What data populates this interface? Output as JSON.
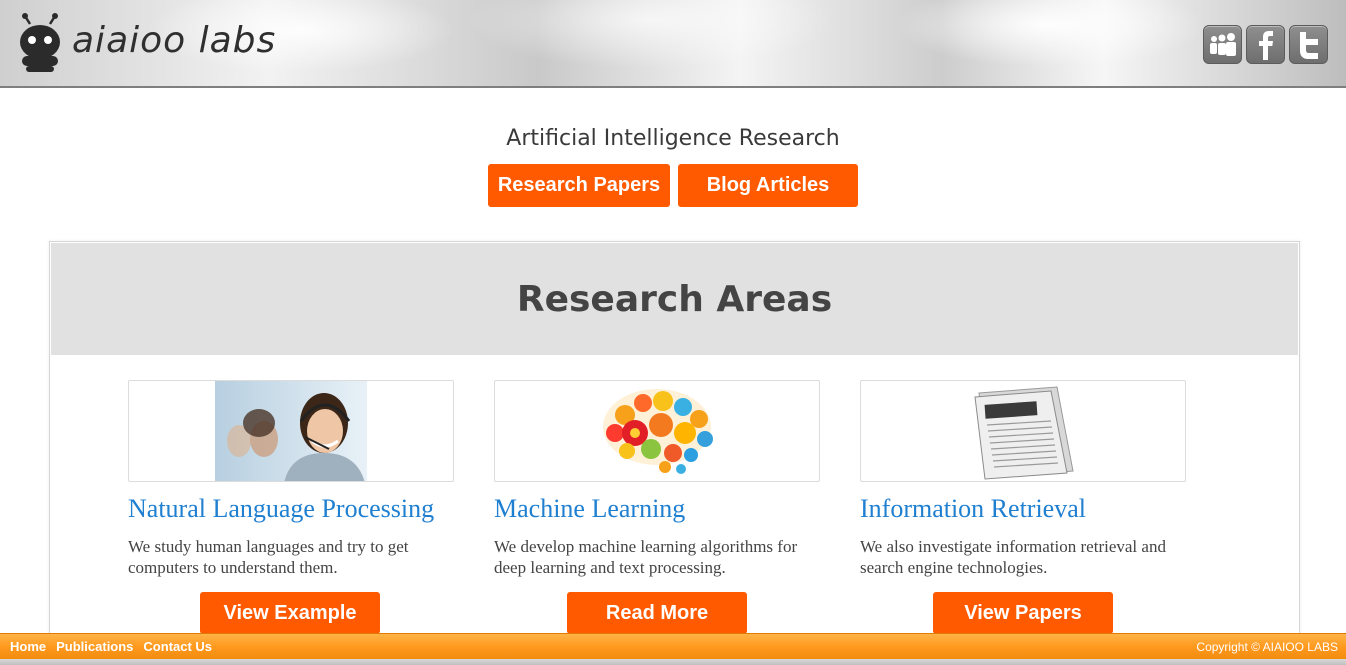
{
  "header": {
    "logo_text": "aiaioo labs",
    "social": [
      {
        "icon": "myspace-icon"
      },
      {
        "icon": "facebook-icon"
      },
      {
        "icon": "twitter-icon"
      }
    ]
  },
  "hero": {
    "title": "Artificial Intelligence Research",
    "buttons": {
      "papers": "Research Papers",
      "blog": "Blog Articles"
    }
  },
  "research": {
    "title": "Research Areas",
    "cards": [
      {
        "title": "Natural Language Processing",
        "text": "We study human languages and try to get computers to understand them.",
        "button": "View Example",
        "image": "call-center-agent-image"
      },
      {
        "title": "Machine Learning",
        "text": "We develop machine learning algorithms for deep learning and text processing.",
        "button": "Read More",
        "image": "gear-brain-image"
      },
      {
        "title": "Information Retrieval",
        "text": "We also investigate information retrieval and search engine technologies.",
        "button": "View Papers",
        "image": "newspaper-image"
      }
    ]
  },
  "footer": {
    "links": [
      "Home",
      "Publications",
      "Contact Us"
    ],
    "copyright": "Copyright © AIAIOO LABS"
  },
  "colors": {
    "accent_orange": "#ff5a00",
    "link_blue": "#1f7fd0",
    "footer_orange": "#ff9a1f",
    "panel_grey": "#e1e1e1"
  }
}
